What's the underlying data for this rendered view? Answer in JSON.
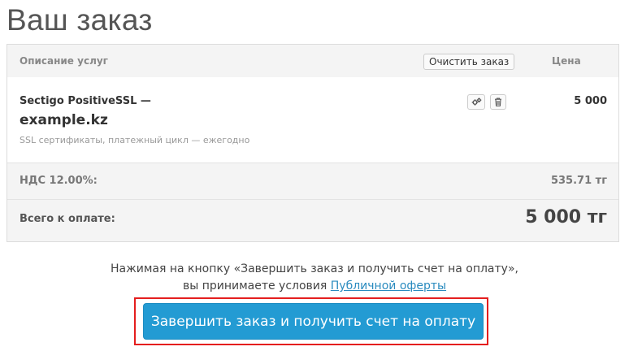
{
  "page": {
    "title": "Ваш заказ"
  },
  "cart": {
    "header": {
      "description_label": "Описание услуг",
      "empty_button_label": "Очистить заказ",
      "price_label": "Цена"
    },
    "item": {
      "name": "Sectigo PositiveSSL —",
      "domain": "example.kz",
      "description": "SSL сертификаты, платежный цикл — ежегодно",
      "price": "5 000",
      "icons": [
        "gears-icon",
        "trash-icon"
      ]
    },
    "tax": {
      "label": "НДС 12.00%:",
      "value": "535.71 тг"
    },
    "total": {
      "label": "Всего к оплате:",
      "value": "5 000 тг"
    }
  },
  "terms": {
    "line1": "Нажимая на кнопку «Завершить заказ и получить счет на оплату»,",
    "line2_prefix": "вы принимаете условия ",
    "link_text": "Публичной оферты"
  },
  "checkout": {
    "button_label": "Завершить заказ и получить счет на оплату"
  },
  "colors": {
    "accent": "#239bd3",
    "highlight": "#e41e1e",
    "link": "#2a8bbf"
  }
}
